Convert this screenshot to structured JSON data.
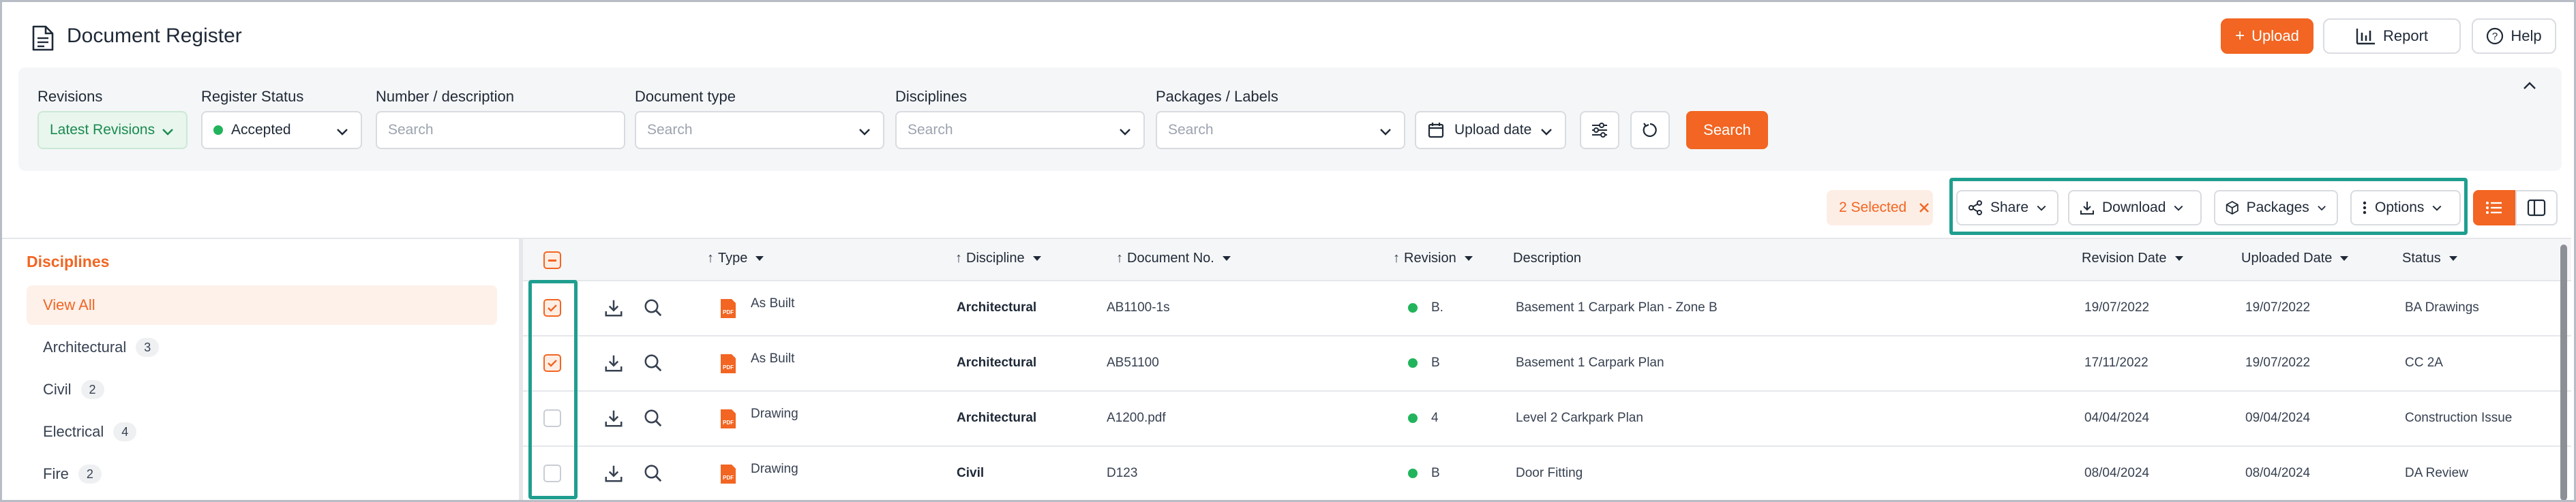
{
  "page": {
    "title": "Document Register"
  },
  "header": {
    "upload_label": "Upload",
    "report_label": "Report",
    "help_label": "Help"
  },
  "filters": {
    "revisions": {
      "label": "Revisions",
      "value": "Latest Revisions"
    },
    "register_status": {
      "label": "Register Status",
      "value": "Accepted"
    },
    "number_description": {
      "label": "Number / description",
      "placeholder": "Search"
    },
    "document_type": {
      "label": "Document type",
      "placeholder": "Search"
    },
    "disciplines": {
      "label": "Disciplines",
      "placeholder": "Search"
    },
    "packages_labels": {
      "label": "Packages / Labels",
      "placeholder": "Search"
    },
    "upload_date": {
      "value": "Upload date"
    },
    "search_label": "Search"
  },
  "toolbar": {
    "selected_label": "2 Selected",
    "share_label": "Share",
    "download_label": "Download",
    "packages_label": "Packages",
    "options_label": "Options"
  },
  "sidebar": {
    "title": "Disciplines",
    "items": [
      {
        "label": "View All",
        "count": ""
      },
      {
        "label": "Architectural",
        "count": "3"
      },
      {
        "label": "Civil",
        "count": "2"
      },
      {
        "label": "Electrical",
        "count": "4"
      },
      {
        "label": "Fire",
        "count": "2"
      }
    ]
  },
  "table": {
    "columns": {
      "type": "Type",
      "discipline": "Discipline",
      "document_no": "Document No.",
      "revision": "Revision",
      "description": "Description",
      "revision_date": "Revision Date",
      "uploaded_date": "Uploaded Date",
      "status": "Status"
    },
    "rows": [
      {
        "checked": true,
        "type": "As Built",
        "discipline": "Architectural",
        "document_no": "AB1100-1s",
        "revision": "B.",
        "description": "Basement 1 Carpark Plan - Zone B",
        "revision_date": "19/07/2022",
        "uploaded_date": "19/07/2022",
        "status": "BA Drawings"
      },
      {
        "checked": true,
        "type": "As Built",
        "discipline": "Architectural",
        "document_no": "AB51100",
        "revision": "B",
        "description": "Basement 1 Carpark Plan",
        "revision_date": "17/11/2022",
        "uploaded_date": "19/07/2022",
        "status": "CC 2A"
      },
      {
        "checked": false,
        "type": "Drawing",
        "discipline": "Architectural",
        "document_no": "A1200.pdf",
        "revision": "4",
        "description": "Level 2 Carkpark Plan",
        "revision_date": "04/04/2024",
        "uploaded_date": "09/04/2024",
        "status": "Construction Issue"
      },
      {
        "checked": false,
        "type": "Drawing",
        "discipline": "Civil",
        "document_no": "D123",
        "revision": "B",
        "description": "Door Fitting",
        "revision_date": "08/04/2024",
        "uploaded_date": "08/04/2024",
        "status": "DA Review"
      }
    ]
  },
  "icons": {
    "doc": "document-icon",
    "upload": "plus-icon",
    "report": "bar-chart-icon",
    "help": "help-circle-icon",
    "chevron": "chevron-down-icon",
    "collapse": "chevron-up-icon",
    "tune": "sliders-icon",
    "reset": "refresh-icon",
    "calendar": "calendar-icon",
    "share": "share-icon",
    "download": "download-icon",
    "package": "package-icon",
    "options": "more-vertical-icon",
    "close": "close-icon",
    "list": "list-view-icon",
    "split": "split-view-icon",
    "search": "magnifier-icon",
    "pdf": "pdf-file-icon"
  },
  "colors": {
    "accent": "#f26522",
    "success": "#22b45c",
    "highlight": "#1f9e8f"
  }
}
